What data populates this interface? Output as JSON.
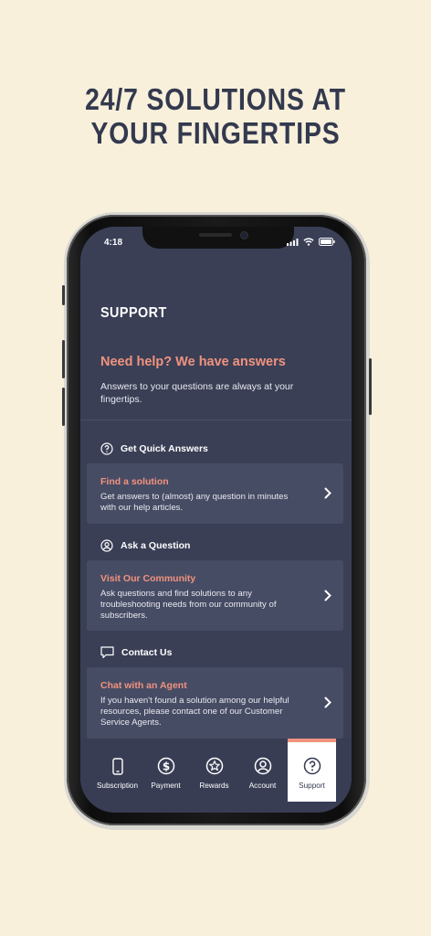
{
  "headline": {
    "line1": "24/7 SOLUTIONS AT",
    "line2": "YOUR FINGERTIPS"
  },
  "status_bar": {
    "time": "4:18"
  },
  "page": {
    "title": "SUPPORT",
    "hero_title": "Need help? We have answers",
    "hero_subtitle": "Answers to your questions are always at your fingertips."
  },
  "sections": [
    {
      "heading": "Get Quick Answers",
      "icon": "question-circle-icon",
      "card_title": "Find a solution",
      "card_body": "Get answers to (almost) any question in minutes with our help articles."
    },
    {
      "heading": "Ask a Question",
      "icon": "user-circle-icon",
      "card_title": "Visit Our Community",
      "card_body": "Ask questions and find solutions to any troubleshooting needs from our community of subscribers."
    },
    {
      "heading": "Contact Us",
      "icon": "chat-bubble-icon",
      "card_title": "Chat with an Agent",
      "card_body": "If you haven't found a solution among our helpful resources, please contact one of our Customer Service Agents."
    }
  ],
  "tabs": [
    {
      "label": "Subscription",
      "icon": "phone-icon"
    },
    {
      "label": "Payment",
      "icon": "dollar-circle-icon"
    },
    {
      "label": "Rewards",
      "icon": "star-circle-icon"
    },
    {
      "label": "Account",
      "icon": "user-circle-icon"
    },
    {
      "label": "Support",
      "icon": "question-circle-icon",
      "active": true
    }
  ],
  "colors": {
    "background": "#f8f0db",
    "screen": "#3a3f56",
    "card": "#474c65",
    "accent": "#f0937d",
    "headline": "#33394e"
  }
}
